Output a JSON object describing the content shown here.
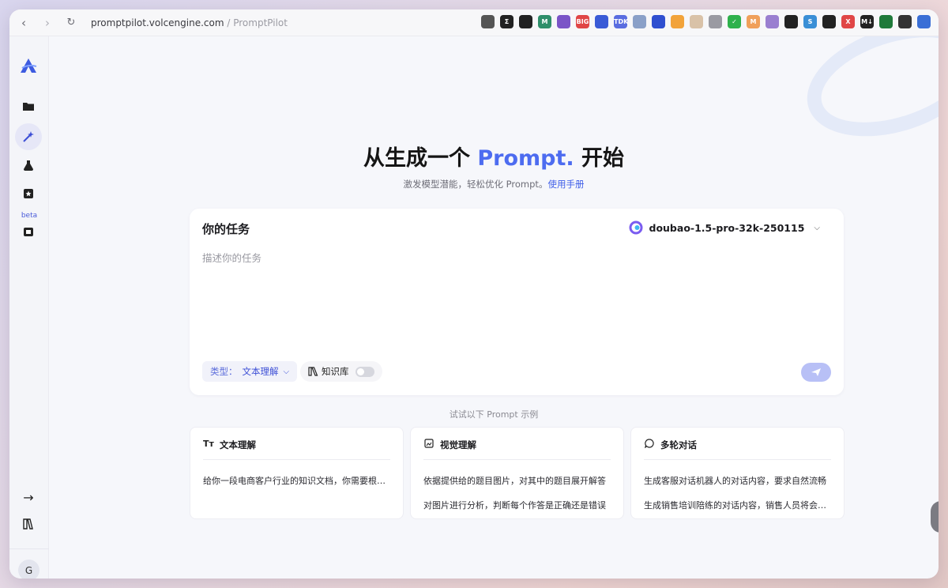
{
  "browser": {
    "url_host": "promptpilot.volcengine.com",
    "url_path": " / PromptPilot",
    "extensions": [
      {
        "icon": "circle-avatar-ext",
        "color": "#555555",
        "label": ""
      },
      {
        "icon": "sigma-ext",
        "color": "#222222",
        "label": "Σ"
      },
      {
        "icon": "bot-ext",
        "color": "#222222",
        "label": ""
      },
      {
        "icon": "m-ext",
        "color": "#2f8f6a",
        "label": "M"
      },
      {
        "icon": "purple-ext",
        "color": "#7b55c7",
        "label": ""
      },
      {
        "icon": "red-ext",
        "color": "#e04646",
        "label": "BIG"
      },
      {
        "icon": "layers-ext",
        "color": "#3a5bd6",
        "label": ""
      },
      {
        "icon": "tdk-ext",
        "color": "#5a6de0",
        "label": "TDK"
      },
      {
        "icon": "arrow-ext",
        "color": "#8aa0c8",
        "label": ""
      },
      {
        "icon": "feather-ext",
        "color": "#2f4fd0",
        "label": ""
      },
      {
        "icon": "orange-ext",
        "color": "#f2a33a",
        "label": ""
      },
      {
        "icon": "shield-ext",
        "color": "#d9c2a8",
        "label": ""
      },
      {
        "icon": "cycle-ext",
        "color": "#9a9aa2",
        "label": ""
      },
      {
        "icon": "check-ext",
        "color": "#2fb14c",
        "label": "✓"
      },
      {
        "icon": "m-orange-ext",
        "color": "#f0a05a",
        "label": "M"
      },
      {
        "icon": "window-ext",
        "color": "#9a7fd0",
        "label": ""
      },
      {
        "icon": "frame-ext",
        "color": "#222222",
        "label": ""
      },
      {
        "icon": "s-ext",
        "color": "#3a8fd6",
        "label": "S"
      },
      {
        "icon": "dark-ext",
        "color": "#222222",
        "label": ""
      },
      {
        "icon": "x-ext",
        "color": "#e04646",
        "label": "X"
      },
      {
        "icon": "md-ext",
        "color": "#222222",
        "label": "M↓"
      },
      {
        "icon": "green-ext",
        "color": "#1f7a3a",
        "label": ""
      },
      {
        "icon": "panda-ext",
        "color": "#333333",
        "label": ""
      },
      {
        "icon": "tabs-ext",
        "color": "#3a6fd6",
        "label": ""
      }
    ]
  },
  "hero": {
    "title_pre": "从生成一个 ",
    "title_accent": "Prompt.",
    "title_post": " 开始",
    "subtitle": "激发模型潜能，轻松优化 Prompt。",
    "manual_link": "使用手册"
  },
  "task": {
    "label": "你的任务",
    "model": "doubao-1.5-pro-32k-250115",
    "placeholder": "描述你的任务",
    "value": "",
    "type_prefix": "类型：",
    "type_value": "文本理解",
    "kb_label": "知识库",
    "kb_enabled": false
  },
  "examples": {
    "title": "试试以下 Prompt 示例",
    "cards": [
      {
        "icon": "text-size-icon",
        "title": "文本理解",
        "lines": [
          "给你一段电商客户行业的知识文档，你需要根据文档内容回答问题"
        ]
      },
      {
        "icon": "image-icon",
        "title": "视觉理解",
        "lines": [
          "依据提供给的题目图片，对其中的题目展开解答",
          "对图片进行分析，判断每个作答是正确还是错误"
        ]
      },
      {
        "icon": "chat-icon",
        "title": "多轮对话",
        "lines": [
          "生成客服对话机器人的对话内容，要求自然流畅",
          "生成销售培训陪练的对话内容，销售人员将会提问"
        ]
      }
    ]
  },
  "rail": {
    "beta_label": "beta",
    "avatar_initial": "G"
  },
  "colors": {
    "accent": "#4d6cf0",
    "send_disabled": "#b8c0f6"
  }
}
